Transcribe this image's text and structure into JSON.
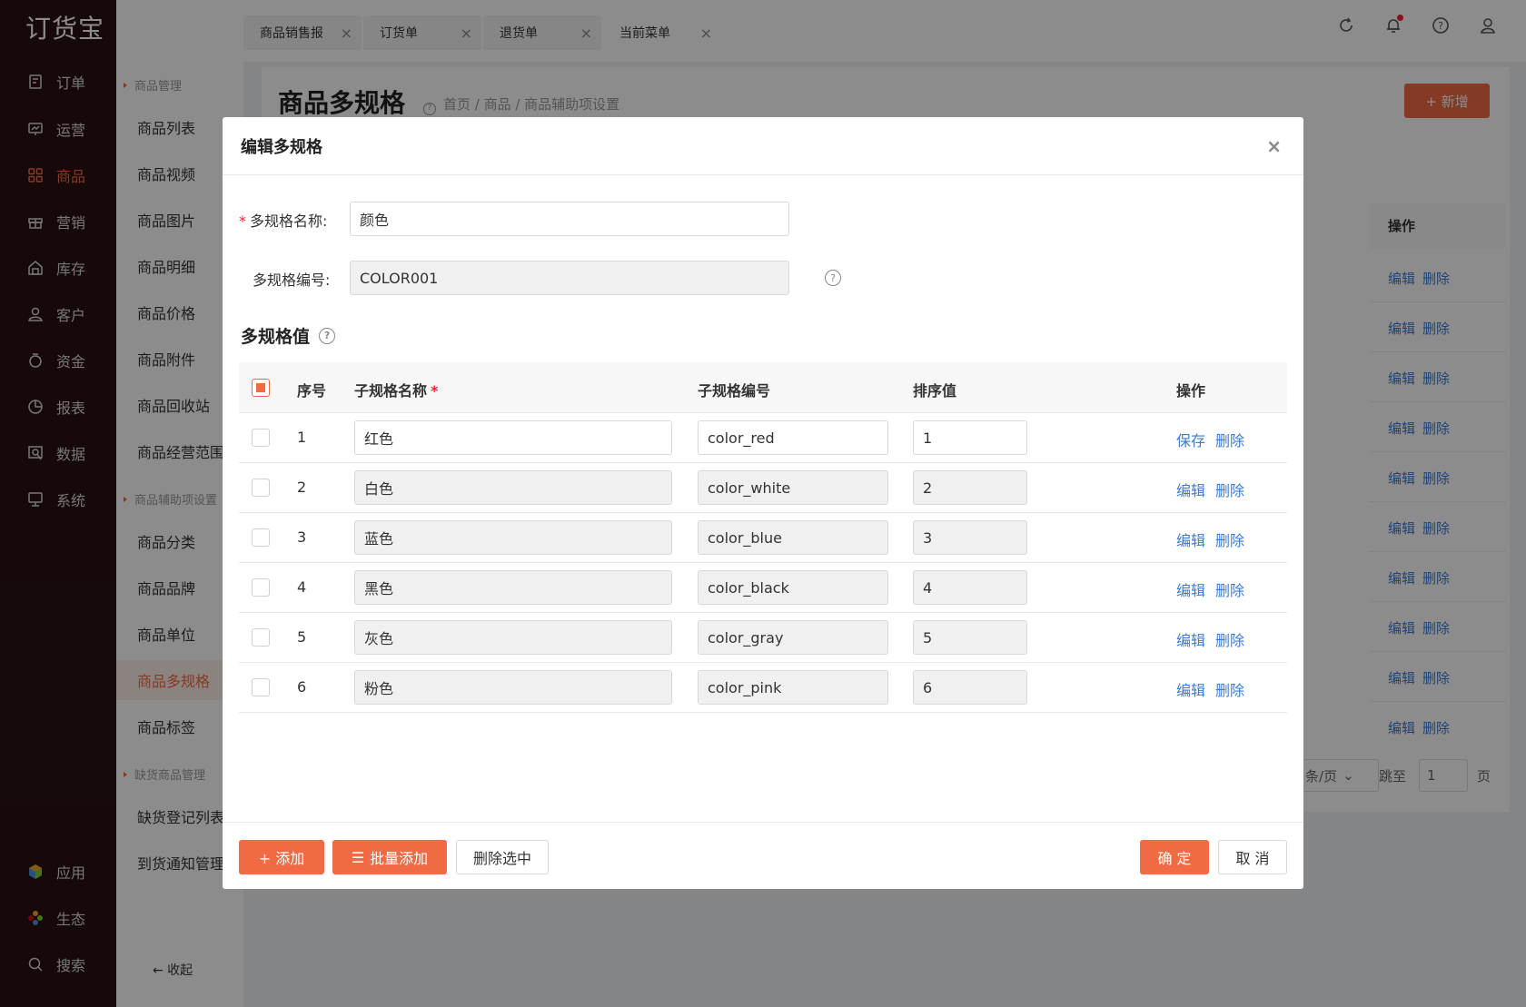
{
  "app": {
    "logo": "订货宝"
  },
  "nav": [
    {
      "label": "订单",
      "icon": "order-icon"
    },
    {
      "label": "运营",
      "icon": "operation-icon"
    },
    {
      "label": "商品",
      "icon": "goods-icon",
      "active": true
    },
    {
      "label": "营销",
      "icon": "gift-icon"
    },
    {
      "label": "库存",
      "icon": "warehouse-icon"
    },
    {
      "label": "客户",
      "icon": "user-icon"
    },
    {
      "label": "资金",
      "icon": "money-icon"
    },
    {
      "label": "报表",
      "icon": "pie-chart-icon"
    },
    {
      "label": "数据",
      "icon": "data-icon"
    },
    {
      "label": "系统",
      "icon": "monitor-icon"
    }
  ],
  "nav_bottom": [
    {
      "label": "应用",
      "icon": "app-cube-icon"
    },
    {
      "label": "生态",
      "icon": "ecology-icon"
    },
    {
      "label": "搜索",
      "icon": "search-icon"
    }
  ],
  "subnav": {
    "group1": "商品管理",
    "items1": [
      "商品列表",
      "商品视频",
      "商品图片",
      "商品明细",
      "商品价格",
      "商品附件",
      "商品回收站",
      "商品经营范围"
    ],
    "group2": "商品辅助项设置",
    "items2": [
      "商品分类",
      "商品品牌",
      "商品单位",
      "商品多规格",
      "商品标签"
    ],
    "group3": "缺货商品管理",
    "items3": [
      "缺货登记列表",
      "到货通知管理"
    ],
    "collapse": "← 收起"
  },
  "tabs": [
    "商品销售报",
    "订货单",
    "退货单",
    "当前菜单"
  ],
  "page": {
    "title": "商品多规格",
    "breadcrumb": "首页 / 商品 / 商品辅助项设置",
    "new_button": "+ 新增",
    "op_header": "操作",
    "edit": "编辑",
    "delete": "删除",
    "page_size": "条/页",
    "jump_label": "跳至",
    "jump_value": "1",
    "page_suffix": "页"
  },
  "modal": {
    "title": "编辑多规格",
    "name_label": "多规格名称:",
    "name_value": "颜色",
    "code_label": "多规格编号:",
    "code_value": "COLOR001",
    "section_title": "多规格值",
    "columns": {
      "index": "序号",
      "name": "子规格名称",
      "code": "子规格编号",
      "sort": "排序值",
      "ops": "操作"
    },
    "rows": [
      {
        "index": "1",
        "name": "红色",
        "code": "color_red",
        "sort": "1",
        "op1": "保存",
        "op2": "删除",
        "editing": true
      },
      {
        "index": "2",
        "name": "白色",
        "code": "color_white",
        "sort": "2",
        "op1": "编辑",
        "op2": "删除"
      },
      {
        "index": "3",
        "name": "蓝色",
        "code": "color_blue",
        "sort": "3",
        "op1": "编辑",
        "op2": "删除"
      },
      {
        "index": "4",
        "name": "黑色",
        "code": "color_black",
        "sort": "4",
        "op1": "编辑",
        "op2": "删除"
      },
      {
        "index": "5",
        "name": "灰色",
        "code": "color_gray",
        "sort": "5",
        "op1": "编辑",
        "op2": "删除"
      },
      {
        "index": "6",
        "name": "粉色",
        "code": "color_pink",
        "sort": "6",
        "op1": "编辑",
        "op2": "删除"
      }
    ],
    "add_button": "+ 添加",
    "batch_add_button": "批量添加",
    "delete_selected_button": "删除选中",
    "confirm_button": "确 定",
    "cancel_button": "取 消"
  },
  "colors": {
    "accent": "#f06a44",
    "link": "#3a7bd5",
    "nav_bg": "#2a1212"
  }
}
